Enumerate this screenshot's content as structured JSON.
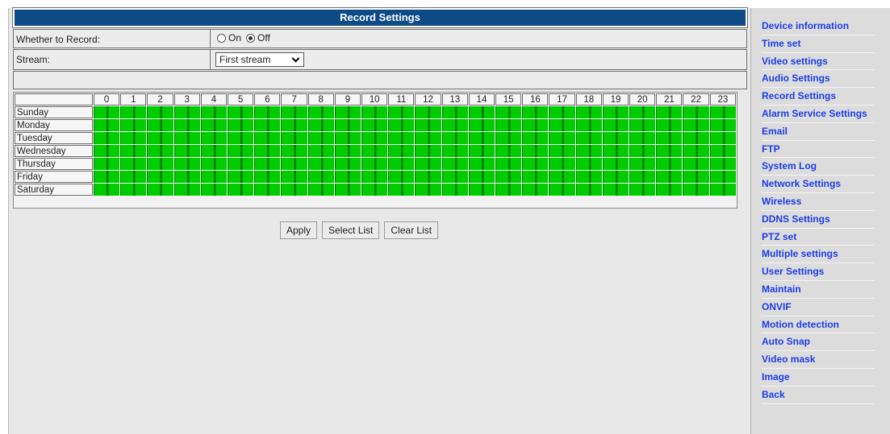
{
  "page": {
    "title": "Record Settings"
  },
  "form": {
    "record": {
      "label": "Whether to Record:",
      "options": [
        "On",
        "Off"
      ],
      "selected": "Off"
    },
    "stream": {
      "label": "Stream:",
      "value": "First stream"
    }
  },
  "schedule": {
    "hours": [
      "0",
      "1",
      "2",
      "3",
      "4",
      "5",
      "6",
      "7",
      "8",
      "9",
      "10",
      "11",
      "12",
      "13",
      "14",
      "15",
      "16",
      "17",
      "18",
      "19",
      "20",
      "21",
      "22",
      "23"
    ],
    "days": [
      "Sunday",
      "Monday",
      "Tuesday",
      "Wednesday",
      "Thursday",
      "Friday",
      "Saturday"
    ],
    "selected_color": "#00cc00",
    "all_selected": true
  },
  "buttons": {
    "apply": "Apply",
    "select_list": "Select List",
    "clear_list": "Clear List"
  },
  "sidebar": {
    "items": [
      "Device information",
      "Time set",
      "Video settings",
      "Audio Settings",
      "Record Settings",
      "Alarm Service Settings",
      "Email",
      "FTP",
      "System Log",
      "Network Settings",
      "Wireless",
      "DDNS Settings",
      "PTZ set",
      "Multiple settings",
      "User Settings",
      "Maintain",
      "ONVIF",
      "Motion detection",
      "Auto Snap",
      "Video mask",
      "Image",
      "Back"
    ]
  },
  "colors": {
    "title_bar": "#0d4a86",
    "link": "#1e3ce8",
    "schedule_on": "#00cc00"
  }
}
